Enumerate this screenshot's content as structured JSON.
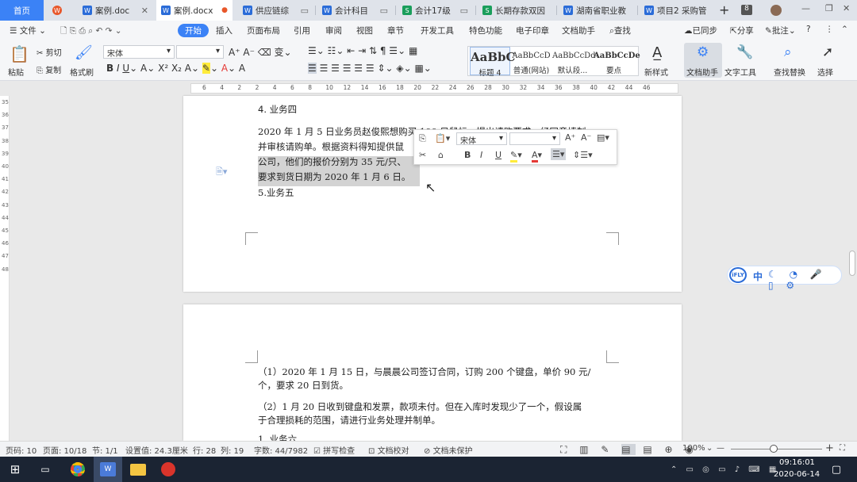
{
  "tabs": {
    "home": "首页",
    "t1": "案例.doc",
    "t2": "案例.docx",
    "t3": "供应链综",
    "t4": "会计科目",
    "t5": "会计17级",
    "t6": "长期存款双因",
    "t7": "湖南省职业教",
    "t8": "项目2  采购管",
    "count": "8"
  },
  "menu": {
    "file": "文件",
    "start": "开始",
    "insert": "插入",
    "layout": "页面布局",
    "ref": "引用",
    "review": "审阅",
    "view": "视图",
    "section": "章节",
    "dev": "开发工具",
    "special": "特色功能",
    "stamp": "电子印章",
    "assistant": "文档助手",
    "find": "查找",
    "sync": "已同步",
    "share": "分享",
    "comment": "批注"
  },
  "ribbon": {
    "paste": "粘贴",
    "cut": "剪切",
    "copy": "复制",
    "format_painter": "格式刷",
    "font": "宋体",
    "styles": [
      {
        "preview": "AaBbC",
        "label": "标题 4"
      },
      {
        "preview": "AaBbCcD",
        "label": "普通(网站)"
      },
      {
        "preview": "AaBbCcDd",
        "label": "默认段..."
      },
      {
        "preview": "AaBbCcDe",
        "label": "要点"
      }
    ],
    "new_style": "新样式",
    "doc_helper": "文档助手",
    "text_tools": "文字工具",
    "find_replace": "查找替换",
    "select": "选择"
  },
  "ruler": [
    "6",
    "4",
    "2",
    "2",
    "4",
    "6",
    "8",
    "10",
    "12",
    "14",
    "16",
    "18",
    "20",
    "22",
    "24",
    "26",
    "28",
    "30",
    "32",
    "34",
    "36",
    "38",
    "40",
    "42",
    "44",
    "46"
  ],
  "vruler": [
    "35",
    "36",
    "37",
    "38",
    "39",
    "40",
    "41",
    "42",
    "43",
    "44",
    "45",
    "46",
    "47",
    "48"
  ],
  "doc": {
    "heading4": "4.  业务四",
    "p1_l1": "2020 年 1 月 5 日业务员赵俊熙想购买 100 只鼠标，提出请购要求，经同意填制",
    "p1_l2": "并审核请购单。根据资料得知提供鼠",
    "p1_l3": "公司，他们的报价分别为 35 元/只、",
    "p1_l4": "要求到货日期为 2020 年 1 月 6 日。",
    "heading5": "5.业务五",
    "p2_l1": "（1）2020 年 1 月 15 日，与晨晨公司签订合同，订购 200 个键盘，单价 90 元/",
    "p2_l2": "个，要求 20 日到货。",
    "p3_l1": "（2）1 月 20 日收到键盘和发票，款项未付。但在入库时发现少了一个，假设属",
    "p3_l2": "于合理损耗的范围，请进行业务处理并制单。",
    "p4": "1.  业务六"
  },
  "minitoolbar": {
    "font": "宋体"
  },
  "ifly": {
    "logo": "iFLY",
    "mode": "中"
  },
  "status": {
    "pagecode": "页码: 10",
    "page": "页面: 10/18",
    "section": "节: 1/1",
    "setting": "设置值: 24.3厘米",
    "row": "行: 28",
    "col": "列: 19",
    "wordcount": "字数: 44/7982",
    "spell": "拼写检查",
    "proof": "文档校对",
    "protect": "文档未保护",
    "zoom": "100%"
  },
  "taskbar": {
    "time": "09:16:01",
    "date": "2020-06-14"
  },
  "colors": {
    "accent": "#3b82f6",
    "taskbar": "#1b2433"
  }
}
